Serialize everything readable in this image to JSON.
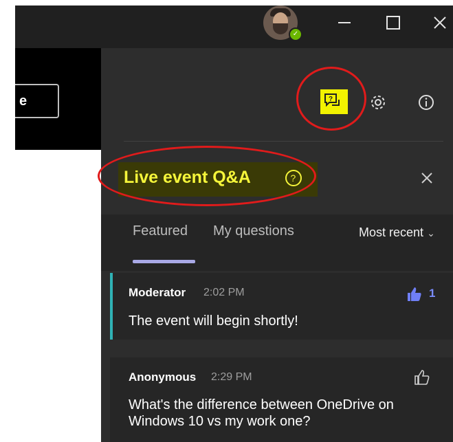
{
  "window": {
    "minimize_symbol": "—",
    "maximize_symbol": "☐",
    "close_symbol": "✕"
  },
  "left": {
    "button_partial_label": "e"
  },
  "panel": {
    "icons": [
      "qa-icon",
      "gear-icon",
      "info-icon"
    ],
    "title": "Live event Q&A",
    "help_symbol": "?",
    "close_symbol": "✕",
    "tabs": [
      {
        "label": "Featured",
        "active": true
      },
      {
        "label": "My questions",
        "active": false
      }
    ],
    "sort_label": "Most recent",
    "questions": [
      {
        "author": "Moderator",
        "time": "2:02 PM",
        "text": "The event will begin shortly!",
        "likes": "1",
        "liked": true
      },
      {
        "author": "Anonymous",
        "time": "2:29 PM",
        "text": "What's the difference between OneDrive on Windows 10 vs my work one?",
        "likes": "",
        "liked": false
      }
    ]
  },
  "colors": {
    "highlight": "#f5f53a",
    "accent_teal": "#30b2b5",
    "like_blue": "#7a8dff",
    "annotation_red": "#e01b1b"
  }
}
